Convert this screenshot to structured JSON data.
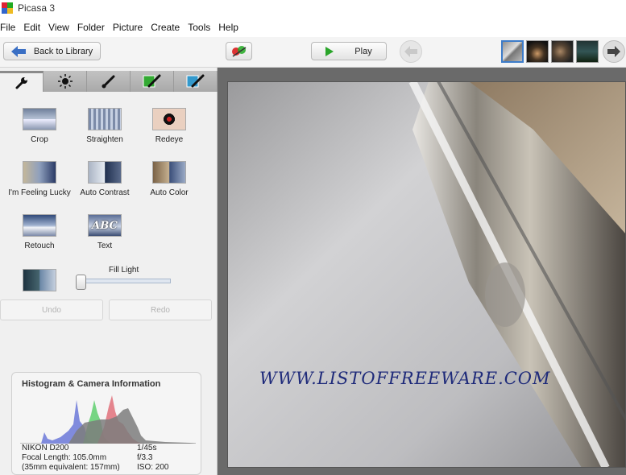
{
  "window": {
    "title": "Picasa 3"
  },
  "menu": [
    "File",
    "Edit",
    "View",
    "Folder",
    "Picture",
    "Create",
    "Tools",
    "Help"
  ],
  "toolbar": {
    "back_label": "Back to Library",
    "play_label": "Play"
  },
  "tabs": [
    {
      "icon": "wrench-icon"
    },
    {
      "icon": "sun-icon"
    },
    {
      "icon": "brush-icon"
    },
    {
      "icon": "green-brush-icon"
    },
    {
      "icon": "blue-brush-icon"
    }
  ],
  "tools": {
    "crop": "Crop",
    "straighten": "Straighten",
    "redeye": "Redeye",
    "lucky": "I'm Feeling Lucky",
    "auto_contrast": "Auto Contrast",
    "auto_color": "Auto Color",
    "retouch": "Retouch",
    "text": "Text",
    "text_icon_glyph": "ABC"
  },
  "fill_light": {
    "label": "Fill Light",
    "value": 0
  },
  "actions": {
    "undo": "Undo",
    "redo": "Redo"
  },
  "histogram": {
    "title": "Histogram & Camera Information",
    "camera": "NIKON D200",
    "focal_length": "Focal Length: 105.0mm",
    "equivalent": "(35mm equivalent: 157mm)",
    "shutter": "1/45s",
    "aperture": "f/3.3",
    "iso": "ISO: 200"
  },
  "watermark": "WWW.LISTOFFREEWARE.COM",
  "colors": {
    "accent": "#3d7cc9",
    "play_green": "#2aa52a",
    "watermark": "#1e2a7a"
  }
}
